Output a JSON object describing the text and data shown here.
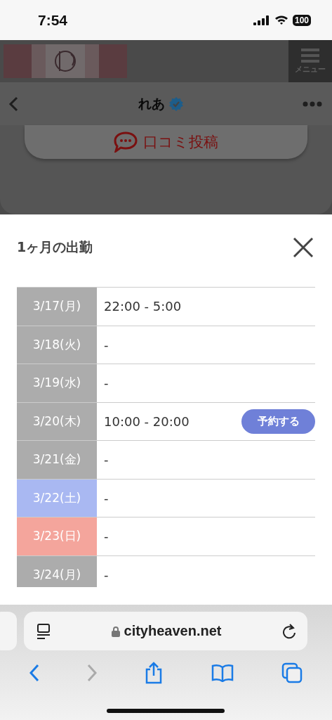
{
  "status_bar": {
    "time": "7:54",
    "battery": "100"
  },
  "site_header": {
    "menu_label": "メニュー"
  },
  "profile_nav": {
    "name": "れあ",
    "verified": true
  },
  "review_button": {
    "label": "口コミ投稿"
  },
  "schedule_sheet": {
    "title": "1ヶ月の出勤",
    "rows": [
      {
        "date": "3/17(月)",
        "kind": "weekday",
        "hours": "22:00 - 5:00"
      },
      {
        "date": "3/18(火)",
        "kind": "weekday",
        "hours": "-"
      },
      {
        "date": "3/19(水)",
        "kind": "weekday",
        "hours": "-"
      },
      {
        "date": "3/20(木)",
        "kind": "weekday",
        "hours": "10:00 - 20:00",
        "button": "予約する"
      },
      {
        "date": "3/21(金)",
        "kind": "weekday",
        "hours": "-"
      },
      {
        "date": "3/22(土)",
        "kind": "saturday",
        "hours": "-"
      },
      {
        "date": "3/23(日)",
        "kind": "sunday",
        "hours": "-"
      },
      {
        "date": "3/24(月)",
        "kind": "weekday",
        "hours": "-"
      }
    ]
  },
  "browser": {
    "url": "cityheaven.net",
    "back_disabled": false,
    "forward_disabled": true
  }
}
